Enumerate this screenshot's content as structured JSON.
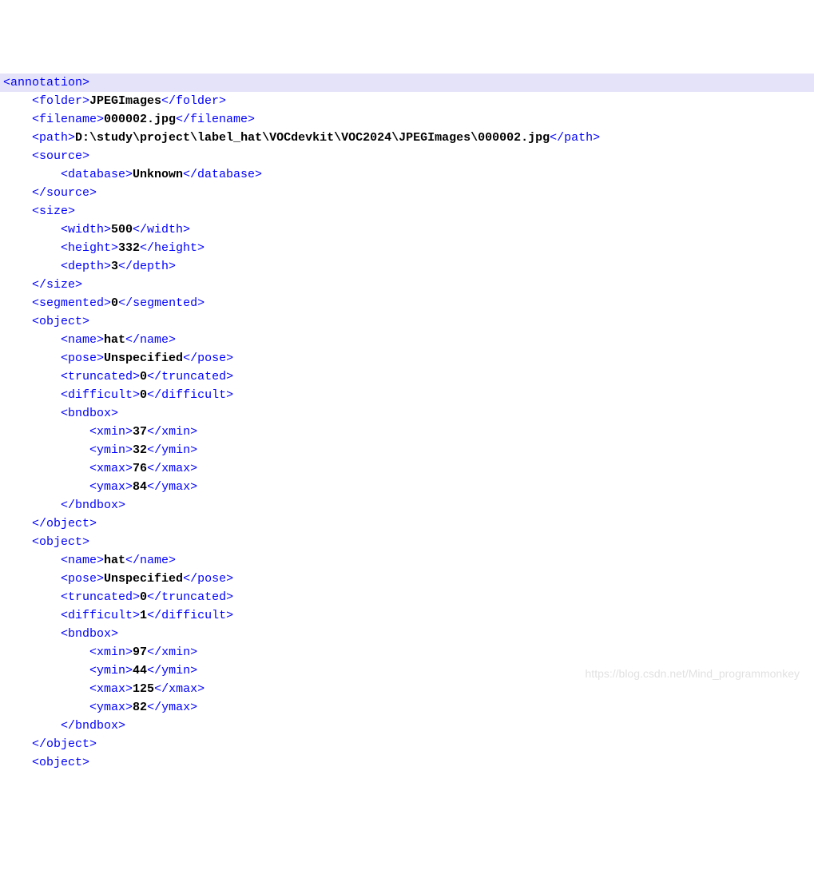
{
  "watermark": "https://blog.csdn.net/Mind_programmonkey",
  "lines": [
    {
      "indent": 0,
      "highlight": true,
      "t": "open",
      "tag": "annotation"
    },
    {
      "indent": 1,
      "t": "leaf",
      "tag": "folder",
      "val": "JPEGImages"
    },
    {
      "indent": 1,
      "t": "leaf",
      "tag": "filename",
      "val": "000002.jpg"
    },
    {
      "indent": 1,
      "t": "leaf",
      "tag": "path",
      "val": "D:\\study\\project\\label_hat\\VOCdevkit\\VOC2024\\JPEGImages\\000002.jpg"
    },
    {
      "indent": 1,
      "t": "open",
      "tag": "source"
    },
    {
      "indent": 2,
      "t": "leaf",
      "tag": "database",
      "val": "Unknown"
    },
    {
      "indent": 1,
      "t": "close",
      "tag": "source"
    },
    {
      "indent": 1,
      "t": "open",
      "tag": "size"
    },
    {
      "indent": 2,
      "t": "leaf",
      "tag": "width",
      "val": "500"
    },
    {
      "indent": 2,
      "t": "leaf",
      "tag": "height",
      "val": "332"
    },
    {
      "indent": 2,
      "t": "leaf",
      "tag": "depth",
      "val": "3"
    },
    {
      "indent": 1,
      "t": "close",
      "tag": "size"
    },
    {
      "indent": 1,
      "t": "leaf",
      "tag": "segmented",
      "val": "0"
    },
    {
      "indent": 1,
      "t": "open",
      "tag": "object"
    },
    {
      "indent": 2,
      "t": "leaf",
      "tag": "name",
      "val": "hat"
    },
    {
      "indent": 2,
      "t": "leaf",
      "tag": "pose",
      "val": "Unspecified"
    },
    {
      "indent": 2,
      "t": "leaf",
      "tag": "truncated",
      "val": "0"
    },
    {
      "indent": 2,
      "t": "leaf",
      "tag": "difficult",
      "val": "0"
    },
    {
      "indent": 2,
      "t": "open",
      "tag": "bndbox"
    },
    {
      "indent": 3,
      "t": "leaf",
      "tag": "xmin",
      "val": "37"
    },
    {
      "indent": 3,
      "t": "leaf",
      "tag": "ymin",
      "val": "32"
    },
    {
      "indent": 3,
      "t": "leaf",
      "tag": "xmax",
      "val": "76"
    },
    {
      "indent": 3,
      "t": "leaf",
      "tag": "ymax",
      "val": "84"
    },
    {
      "indent": 2,
      "t": "close",
      "tag": "bndbox"
    },
    {
      "indent": 1,
      "t": "close",
      "tag": "object"
    },
    {
      "indent": 1,
      "t": "open",
      "tag": "object"
    },
    {
      "indent": 2,
      "t": "leaf",
      "tag": "name",
      "val": "hat"
    },
    {
      "indent": 2,
      "t": "leaf",
      "tag": "pose",
      "val": "Unspecified"
    },
    {
      "indent": 2,
      "t": "leaf",
      "tag": "truncated",
      "val": "0"
    },
    {
      "indent": 2,
      "t": "leaf",
      "tag": "difficult",
      "val": "1"
    },
    {
      "indent": 2,
      "t": "open",
      "tag": "bndbox"
    },
    {
      "indent": 3,
      "t": "leaf",
      "tag": "xmin",
      "val": "97"
    },
    {
      "indent": 3,
      "t": "leaf",
      "tag": "ymin",
      "val": "44"
    },
    {
      "indent": 3,
      "t": "leaf",
      "tag": "xmax",
      "val": "125"
    },
    {
      "indent": 3,
      "t": "leaf",
      "tag": "ymax",
      "val": "82"
    },
    {
      "indent": 2,
      "t": "close",
      "tag": "bndbox"
    },
    {
      "indent": 1,
      "t": "close",
      "tag": "object"
    },
    {
      "indent": 1,
      "t": "open",
      "tag": "object"
    }
  ]
}
